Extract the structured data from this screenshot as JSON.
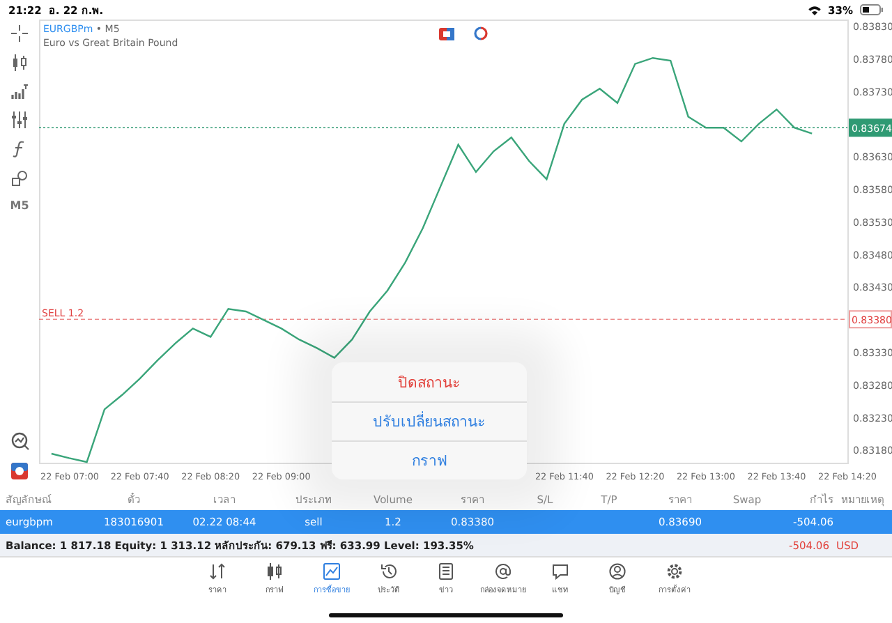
{
  "status_bar": {
    "time": "21:22",
    "date": "อ. 22 ก.พ.",
    "battery": "33%"
  },
  "toolbar": {
    "timeframe": "M5"
  },
  "chart": {
    "symbol": "EURGBPm",
    "timeframe": "• M5",
    "description": "Euro vs Great Britain Pound",
    "chart_data": {
      "type": "line",
      "ylim": [
        0.8316,
        0.8384
      ],
      "categories": [
        null,
        "22 Feb 07:00",
        null,
        null,
        null,
        "22 Feb 07:40",
        null,
        null,
        null,
        "22 Feb 08:20",
        null,
        null,
        null,
        "22 Feb 09:00",
        null,
        null,
        null,
        null,
        null,
        null,
        null,
        null,
        null,
        null,
        null,
        null,
        null,
        null,
        null,
        "22 Feb 11:40",
        null,
        null,
        null,
        "22 Feb 12:20",
        null,
        null,
        null,
        "22 Feb 13:00",
        null,
        null,
        null,
        "22 Feb 13:40",
        null,
        null,
        null,
        "22 Feb 14:20"
      ],
      "series": [
        {
          "color": "#3aa57a",
          "values": [
            0.83174,
            0.83167,
            0.83161,
            0.83242,
            0.83264,
            0.83289,
            0.83317,
            0.83343,
            0.83366,
            0.83353,
            0.83396,
            0.83392,
            0.83379,
            0.83366,
            0.83349,
            0.83336,
            0.83321,
            0.83349,
            0.83392,
            0.83424,
            0.83467,
            0.8352,
            0.83584,
            0.83648,
            0.83606,
            0.83638,
            0.83659,
            0.83623,
            0.83595,
            0.8368,
            0.83717,
            0.83734,
            0.83712,
            0.83772,
            0.83781,
            0.83777,
            0.83691,
            0.83674,
            0.83674,
            0.83653,
            0.8368,
            0.83702,
            0.83674,
            0.83665,
            null,
            null
          ]
        }
      ],
      "yticks": [
        {
          "value": 0.8383,
          "label": "0.83830"
        },
        {
          "value": 0.8378,
          "label": "0.83780"
        },
        {
          "value": 0.8373,
          "label": "0.83730"
        },
        {
          "value": 0.8363,
          "label": "0.83630"
        },
        {
          "value": 0.8358,
          "label": "0.83580"
        },
        {
          "value": 0.8353,
          "label": "0.83530"
        },
        {
          "value": 0.8348,
          "label": "0.83480"
        },
        {
          "value": 0.8343,
          "label": "0.83430"
        },
        {
          "value": 0.8333,
          "label": "0.83330"
        },
        {
          "value": 0.8328,
          "label": "0.83280"
        },
        {
          "value": 0.8323,
          "label": "0.83230"
        },
        {
          "value": 0.8318,
          "label": "0.83180"
        }
      ],
      "ref_lines": [
        {
          "axis": "y",
          "value": 0.83674,
          "label": "0.83674",
          "color": "#2f9a73"
        },
        {
          "axis": "y",
          "value": 0.8338,
          "label": "0.83380",
          "color": "#e04040"
        }
      ],
      "annotations": [
        "SELL 1.2"
      ]
    }
  },
  "popup_menu": [
    {
      "label": "ปิดสถานะ",
      "kind": "destructive"
    },
    {
      "label": "ปรับเปลี่ยนสถานะ",
      "kind": "default"
    },
    {
      "label": "กราฟ",
      "kind": "default"
    }
  ],
  "table": {
    "columns": [
      "สัญลักษณ์",
      "ตั๋ว",
      "เวลา",
      "ประเภท",
      "Volume",
      "ราคา",
      "S/L",
      "T/P",
      "ราคา",
      "Swap",
      "กำไร",
      "หมายเหตุ"
    ],
    "rows": [
      {
        "selected": true,
        "cells": [
          "eurgbpm",
          "183016901",
          "02.22 08:44",
          "sell",
          "1.2",
          "0.83380",
          null,
          null,
          "0.83690",
          null,
          "-504.06",
          null
        ]
      }
    ]
  },
  "summary": {
    "text": "Balance: 1 817.18 Equity: 1 313.12 หลักประกัน: 679.13 ฟรี: 633.99 Level: 193.35%",
    "profit": "-504.06",
    "currency": "USD"
  },
  "tab_bar": [
    {
      "label": "ราคา",
      "kind": "quotes",
      "selected": false
    },
    {
      "label": "กราฟ",
      "kind": "chart",
      "selected": false
    },
    {
      "label": "การซื้อขาย",
      "kind": "trade",
      "selected": true
    },
    {
      "label": "ประวัติ",
      "kind": "history",
      "selected": false
    },
    {
      "label": "ข่าว",
      "kind": "news",
      "selected": false
    },
    {
      "label": "กล่องจดหมาย",
      "kind": "mail",
      "selected": false
    },
    {
      "label": "แชท",
      "kind": "chat",
      "selected": false
    },
    {
      "label": "บัญชี",
      "kind": "account",
      "selected": false
    },
    {
      "label": "การตั้งค่า",
      "kind": "settings",
      "selected": false
    }
  ]
}
